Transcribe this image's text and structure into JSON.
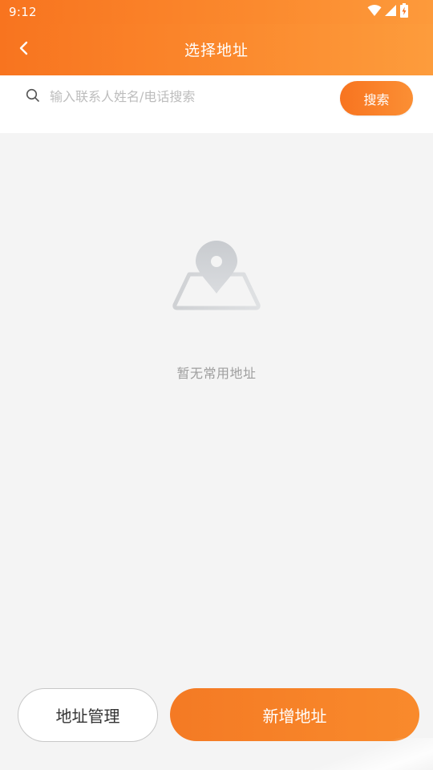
{
  "status_bar": {
    "time": "9:12",
    "icons": [
      "wifi-icon",
      "cellular-signal-icon",
      "battery-charging-icon"
    ]
  },
  "header": {
    "title": "选择地址",
    "back_icon": "chevron-left-icon"
  },
  "search": {
    "placeholder": "输入联系人姓名/电话搜索",
    "value": "",
    "button_label": "搜索",
    "icon": "search-icon"
  },
  "empty_state": {
    "icon": "map-location-pin-icon",
    "message": "暂无常用地址"
  },
  "footer": {
    "manage_label": "地址管理",
    "add_label": "新增地址"
  },
  "colors": {
    "accent": "#F87A22",
    "accent_light": "#FD9A3B",
    "background": "#F4F4F4",
    "empty_text": "#9E9E9E",
    "placeholder": "#BDBDBD"
  }
}
